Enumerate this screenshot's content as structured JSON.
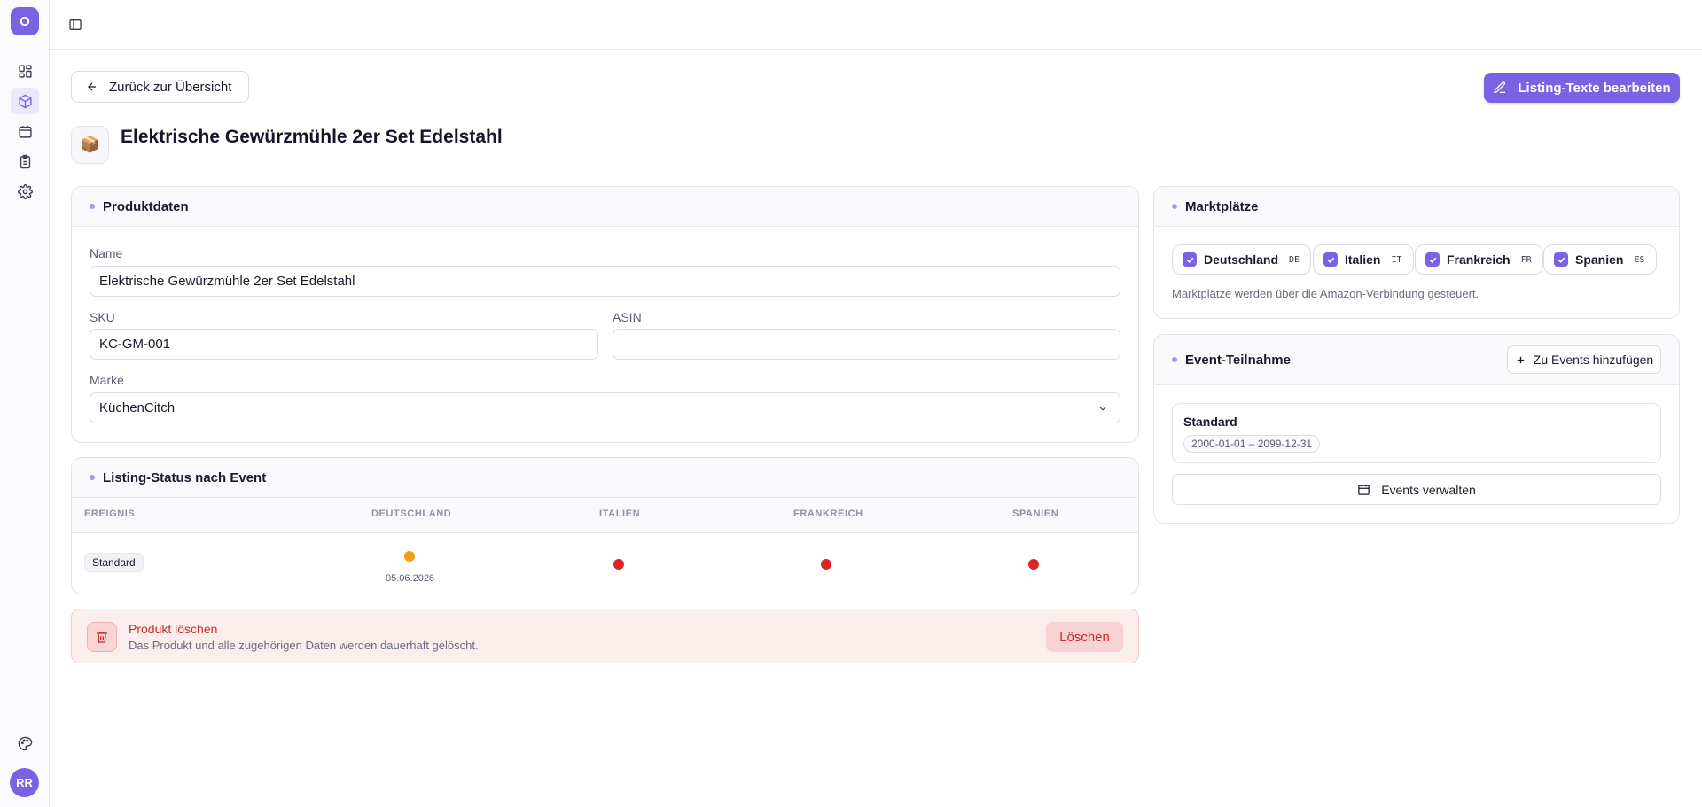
{
  "sidebar": {
    "logo_letter": "O",
    "avatar_initials": "RR"
  },
  "header": {
    "back_label": "Zurück zur Übersicht",
    "edit_label": "Listing-Texte bearbeiten",
    "title": "Elektrische Gewürzmühle 2er Set Edelstahl",
    "product_emoji": "📦"
  },
  "product_data": {
    "section_title": "Produktdaten",
    "name_label": "Name",
    "name_value": "Elektrische Gewürzmühle 2er Set Edelstahl",
    "sku_label": "SKU",
    "sku_value": "KC-GM-001",
    "asin_label": "ASIN",
    "asin_value": "",
    "brand_label": "Marke",
    "brand_value": "KüchenCitch"
  },
  "listing_status": {
    "section_title": "Listing-Status nach Event",
    "columns": [
      "EREIGNIS",
      "DEUTSCHLAND",
      "ITALIEN",
      "FRANKREICH",
      "SPANIEN"
    ],
    "rows": [
      {
        "event": "Standard",
        "statuses": [
          {
            "color": "#f0a00c",
            "date": "05.06.2026"
          },
          {
            "color": "#d92424",
            "date": ""
          },
          {
            "color": "#d92424",
            "date": ""
          },
          {
            "color": "#d92424",
            "date": ""
          }
        ]
      }
    ]
  },
  "delete": {
    "title": "Produkt löschen",
    "description": "Das Produkt und alle zugehörigen Daten werden dauerhaft gelöscht.",
    "button_label": "Löschen"
  },
  "marketplaces": {
    "section_title": "Marktplätze",
    "items": [
      {
        "name": "Deutschland",
        "code": "DE",
        "checked": true
      },
      {
        "name": "Italien",
        "code": "IT",
        "checked": true
      },
      {
        "name": "Frankreich",
        "code": "FR",
        "checked": true
      },
      {
        "name": "Spanien",
        "code": "ES",
        "checked": true
      }
    ],
    "note": "Marktplätze werden über die Amazon-Verbindung gesteuert."
  },
  "events": {
    "section_title": "Event-Teilnahme",
    "add_label": "Zu Events hinzufügen",
    "event_name": "Standard",
    "event_dates": "2000-01-01 – 2099-12-31",
    "manage_label": "Events verwalten"
  },
  "colors": {
    "accent": "#7b61e4",
    "warning": "#f0a00c",
    "error": "#d92424"
  }
}
